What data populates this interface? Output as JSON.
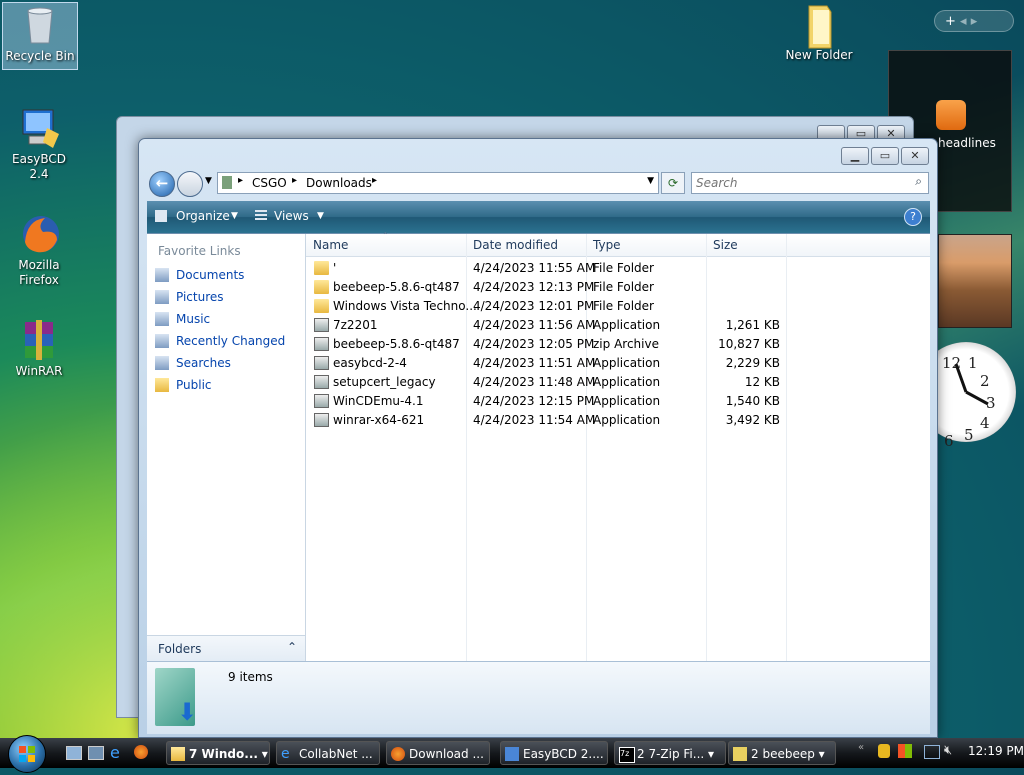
{
  "desktop": {
    "icons": [
      {
        "label": "Recycle Bin"
      },
      {
        "label": "EasyBCD 2.4"
      },
      {
        "label": "Mozilla Firefox"
      },
      {
        "label": "WinRAR"
      },
      {
        "label": "New Folder"
      }
    ]
  },
  "sidebar": {
    "top_button": "+",
    "feed_label": "headlines",
    "clock_numbers": [
      "12",
      "1",
      "2",
      "3",
      "4",
      "5",
      "6"
    ]
  },
  "explorer": {
    "breadcrumb": [
      "CSGO",
      "Downloads"
    ],
    "search_placeholder": "Search",
    "toolbar": {
      "organize": "Organize",
      "views": "Views",
      "help": "?"
    },
    "nav": {
      "header": "Favorite Links",
      "items": [
        "Documents",
        "Pictures",
        "Music",
        "Recently Changed",
        "Searches",
        "Public"
      ],
      "folders_label": "Folders"
    },
    "columns": [
      "Name",
      "Date modified",
      "Type",
      "Size"
    ],
    "files": [
      {
        "name": "'",
        "date": "4/24/2023 11:55 AM",
        "type": "File Folder",
        "size": "",
        "icon": "folder-icon"
      },
      {
        "name": "beebeep-5.8.6-qt487",
        "date": "4/24/2023 12:13 PM",
        "type": "File Folder",
        "size": "",
        "icon": "folder-icon"
      },
      {
        "name": "Windows Vista Techno...",
        "date": "4/24/2023 12:01 PM",
        "type": "File Folder",
        "size": "",
        "icon": "folder-icon"
      },
      {
        "name": "7z2201",
        "date": "4/24/2023 11:56 AM",
        "type": "Application",
        "size": "1,261 KB",
        "icon": "7zip-icon"
      },
      {
        "name": "beebeep-5.8.6-qt487",
        "date": "4/24/2023 12:05 PM",
        "type": "zip Archive",
        "size": "10,827 KB",
        "icon": "zip-icon"
      },
      {
        "name": "easybcd-2-4",
        "date": "4/24/2023 11:51 AM",
        "type": "Application",
        "size": "2,229 KB",
        "icon": "installer-icon"
      },
      {
        "name": "setupcert_legacy",
        "date": "4/24/2023 11:48 AM",
        "type": "Application",
        "size": "12 KB",
        "icon": "app-icon"
      },
      {
        "name": "WinCDEmu-4.1",
        "date": "4/24/2023 12:15 PM",
        "type": "Application",
        "size": "1,540 KB",
        "icon": "wincdemu-icon"
      },
      {
        "name": "winrar-x64-621",
        "date": "4/24/2023 11:54 AM",
        "type": "Application",
        "size": "3,492 KB",
        "icon": "winrar-icon"
      }
    ],
    "status": "9 items"
  },
  "taskbar": {
    "buttons": [
      "7 Windo...",
      "CollabNet ...",
      "Download ...",
      "EasyBCD 2....",
      "2 7-Zip Fi...",
      "2 beebeep"
    ],
    "clock": "12:19 PM"
  },
  "colors": {
    "link": "#0645ad",
    "toolbar": "#2f6a88"
  }
}
